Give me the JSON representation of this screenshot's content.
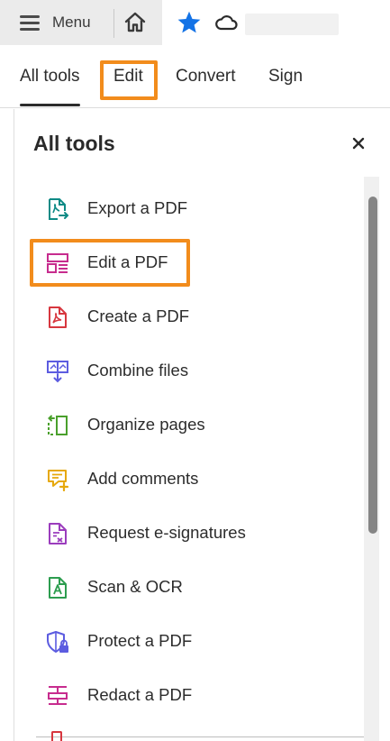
{
  "topbar": {
    "menu_label": "Menu",
    "menu_icon": "hamburger-icon",
    "home_icon": "home-icon",
    "star_icon": "star-icon",
    "cloud_icon": "cloud-icon",
    "star_color": "#1473e6"
  },
  "tabs": [
    {
      "label": "All tools",
      "active": true
    },
    {
      "label": "Edit",
      "highlighted": true
    },
    {
      "label": "Convert"
    },
    {
      "label": "Sign"
    }
  ],
  "panel": {
    "title": "All tools",
    "close_icon": "close-icon",
    "tools": [
      {
        "label": "Export a PDF",
        "icon": "export-pdf-icon",
        "color": "#0d8a85"
      },
      {
        "label": "Edit a PDF",
        "icon": "edit-pdf-icon",
        "color": "#c72c8e",
        "highlighted": true
      },
      {
        "label": "Create a PDF",
        "icon": "create-pdf-icon",
        "color": "#d7373f"
      },
      {
        "label": "Combine files",
        "icon": "combine-files-icon",
        "color": "#5c5ce0"
      },
      {
        "label": "Organize pages",
        "icon": "organize-pages-icon",
        "color": "#4aa02c"
      },
      {
        "label": "Add comments",
        "icon": "add-comments-icon",
        "color": "#e6a80c"
      },
      {
        "label": "Request e-signatures",
        "icon": "request-esign-icon",
        "color": "#9b3dbd"
      },
      {
        "label": "Scan & OCR",
        "icon": "scan-ocr-icon",
        "color": "#2d9d4f"
      },
      {
        "label": "Protect a PDF",
        "icon": "protect-pdf-icon",
        "color": "#5c5ce0"
      },
      {
        "label": "Redact a PDF",
        "icon": "redact-pdf-icon",
        "color": "#c72c8e"
      }
    ]
  },
  "colors": {
    "highlight": "#f28c1c",
    "topbar_bg": "#ebebeb"
  }
}
